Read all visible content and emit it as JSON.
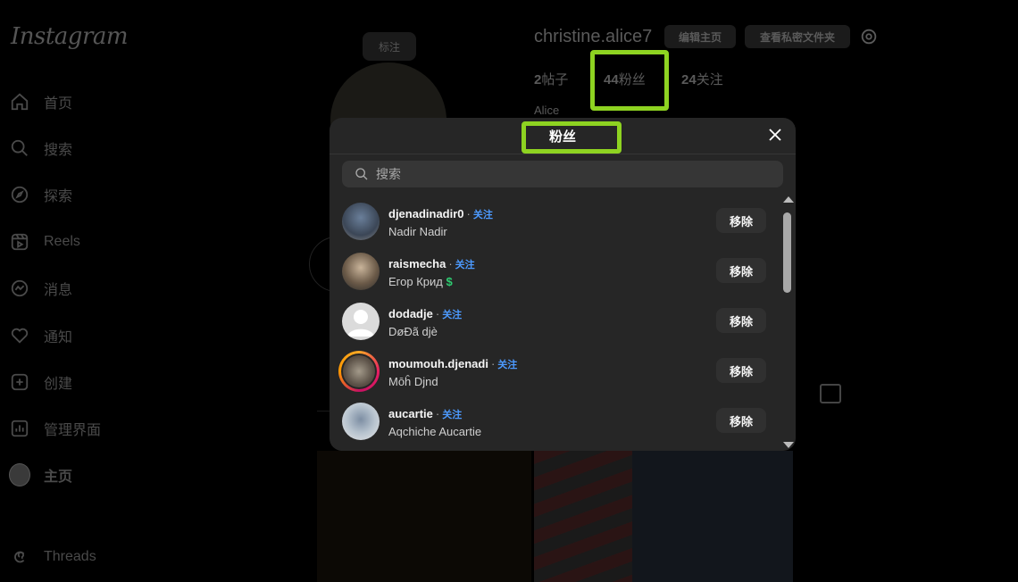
{
  "app": {
    "logo": "Instagram"
  },
  "sidebar": {
    "items": [
      {
        "label": "首页",
        "icon": "home-icon"
      },
      {
        "label": "搜索",
        "icon": "search-icon"
      },
      {
        "label": "探索",
        "icon": "compass-icon"
      },
      {
        "label": "Reels",
        "icon": "reels-icon"
      },
      {
        "label": "消息",
        "icon": "messenger-icon"
      },
      {
        "label": "通知",
        "icon": "heart-icon"
      },
      {
        "label": "创建",
        "icon": "plus-square-icon"
      },
      {
        "label": "管理界面",
        "icon": "dashboard-icon"
      },
      {
        "label": "主页",
        "icon": "avatar"
      },
      {
        "label": "Threads",
        "icon": "threads-icon"
      }
    ]
  },
  "profile": {
    "username": "christine.alice7",
    "edit_label": "编辑主页",
    "archive_label": "查看私密文件夹",
    "posts_count": "2",
    "posts_label": "帖子",
    "followers_count": "44",
    "followers_label": "粉丝",
    "following_count": "24",
    "following_label": "关注",
    "full_name": "Alice",
    "pp_hint": "标注"
  },
  "modal": {
    "title": "粉丝",
    "search_placeholder": "搜索",
    "follow_label": "关注",
    "remove_label": "移除",
    "followers": [
      {
        "username": "djenadinadir0",
        "name": "Nadir Nadir"
      },
      {
        "username": "raismecha",
        "name": "Егор Крид",
        "suffix": "$"
      },
      {
        "username": "dodadje",
        "name": "DøĐã djè"
      },
      {
        "username": "moumouh.djenadi",
        "name": "Mōĥ Djnd"
      },
      {
        "username": "aucartie",
        "name": "Aqchiche Aucartie"
      }
    ]
  },
  "colors": {
    "highlight": "#8ed321",
    "follow_link": "#4c9aff",
    "modal_bg": "#262626"
  }
}
